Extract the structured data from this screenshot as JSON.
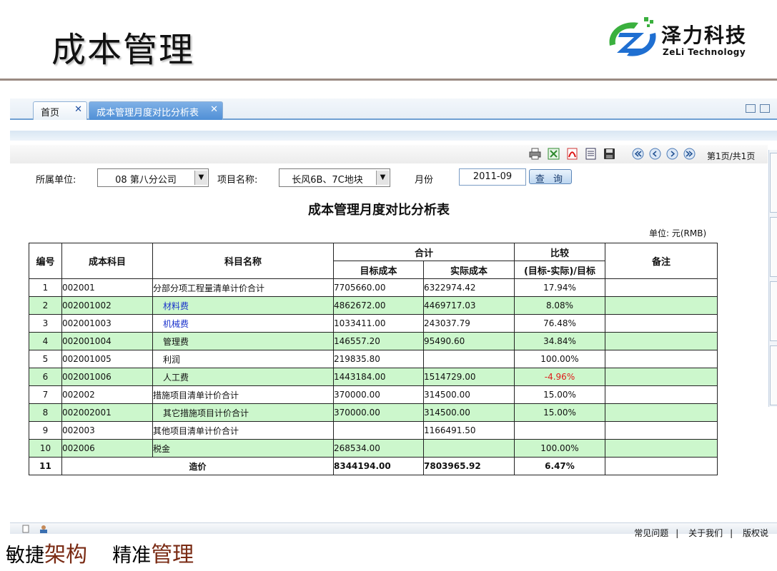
{
  "slide": {
    "title": "成本管理"
  },
  "brand": {
    "name_cn": "泽力科技",
    "name_en": "ZeLi Technology",
    "colors": {
      "green": "#3ab03e",
      "blue": "#1f6fd1"
    }
  },
  "tabs": {
    "home": "首页",
    "active": "成本管理月度对比分析表",
    "close_glyph": "✕"
  },
  "toolbar": {
    "icons": [
      "print-icon",
      "excel-icon",
      "pdf-icon",
      "word-icon",
      "save-icon",
      "first-page-icon",
      "prev-page-icon",
      "next-page-icon",
      "last-page-icon"
    ],
    "page_info": "第1页/共1页"
  },
  "filter": {
    "unit_label": "所属单位:",
    "unit_value": "08 第八分公司",
    "project_label": "项目名称:",
    "project_value": "长风6B、7C地块",
    "month_label": "月份",
    "month_value": "2011-09",
    "query_label": "查 询"
  },
  "report": {
    "title": "成本管理月度对比分析表",
    "unit": "单位: 元(RMB)",
    "headers": {
      "no": "编号",
      "subject": "成本科目",
      "name": "科目名称",
      "total": "合计",
      "target": "目标成本",
      "actual": "实际成本",
      "compare": "比较",
      "compare_formula": "(目标-实际)/目标",
      "remark": "备注"
    },
    "rows": [
      {
        "no": "1",
        "code": "002001",
        "name": "分部分项工程量清单计价合计",
        "target": "7705660.00",
        "actual": "6322974.42",
        "ratio": "17.94%",
        "indent": false,
        "link": false,
        "neg": false
      },
      {
        "no": "2",
        "code": "002001002",
        "name": "材料费",
        "target": "4862672.00",
        "actual": "4469717.03",
        "ratio": "8.08%",
        "indent": true,
        "link": true,
        "neg": false
      },
      {
        "no": "3",
        "code": "002001003",
        "name": "机械费",
        "target": "1033411.00",
        "actual": "243037.79",
        "ratio": "76.48%",
        "indent": true,
        "link": true,
        "neg": false
      },
      {
        "no": "4",
        "code": "002001004",
        "name": "管理费",
        "target": "146557.20",
        "actual": "95490.60",
        "ratio": "34.84%",
        "indent": true,
        "link": false,
        "neg": false
      },
      {
        "no": "5",
        "code": "002001005",
        "name": "利润",
        "target": "219835.80",
        "actual": "",
        "ratio": "100.00%",
        "indent": true,
        "link": false,
        "neg": false
      },
      {
        "no": "6",
        "code": "002001006",
        "name": "人工费",
        "target": "1443184.00",
        "actual": "1514729.00",
        "ratio": "-4.96%",
        "indent": true,
        "link": false,
        "neg": true
      },
      {
        "no": "7",
        "code": "002002",
        "name": "措施项目清单计价合计",
        "target": "370000.00",
        "actual": "314500.00",
        "ratio": "15.00%",
        "indent": false,
        "link": false,
        "neg": false
      },
      {
        "no": "8",
        "code": "002002001",
        "name": "其它措施项目计价合计",
        "target": "370000.00",
        "actual": "314500.00",
        "ratio": "15.00%",
        "indent": true,
        "link": false,
        "neg": false
      },
      {
        "no": "9",
        "code": "002003",
        "name": "其他项目清单计价合计",
        "target": "",
        "actual": "1166491.50",
        "ratio": "",
        "indent": false,
        "link": false,
        "neg": false
      },
      {
        "no": "10",
        "code": "002006",
        "name": "税金",
        "target": "268534.00",
        "actual": "",
        "ratio": "100.00%",
        "indent": false,
        "link": false,
        "neg": false
      }
    ],
    "total": {
      "no": "11",
      "label": "造价",
      "target": "8344194.00",
      "actual": "7803965.92",
      "ratio": "6.47%"
    },
    "colors": {
      "alt_row": "#ccf7cc",
      "link": "#1a33cc",
      "negative": "#e01b1b"
    }
  },
  "footer": {
    "faq": "常见问题",
    "about": "关于我们",
    "copyright": "版权说"
  },
  "slogan": {
    "part1": "敏捷",
    "part2": "架构",
    "part3": "精准",
    "part4": "管理"
  }
}
